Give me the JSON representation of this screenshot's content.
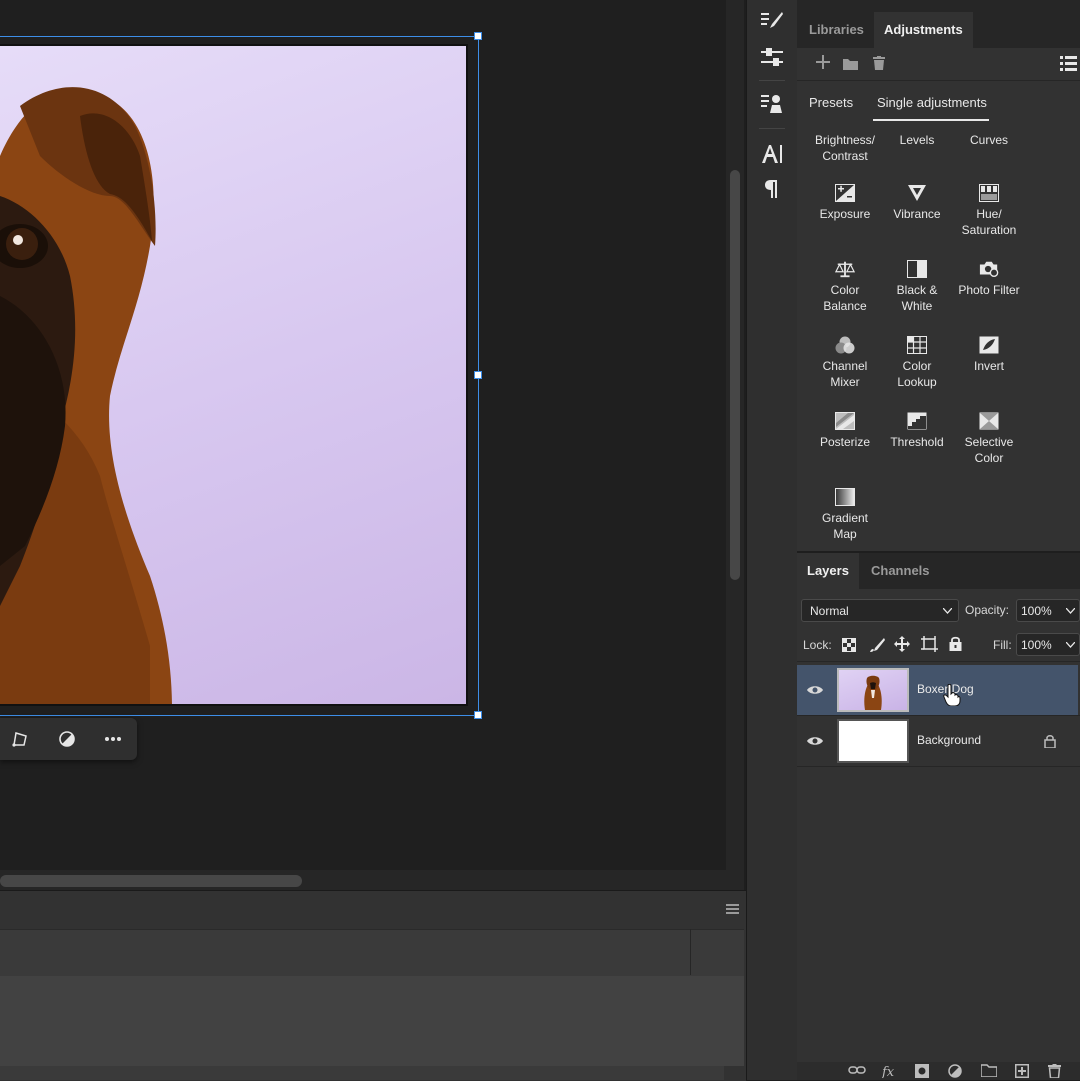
{
  "libraries_panel": {
    "tabs": [
      "Libraries",
      "Adjustments"
    ],
    "active_tab": "Adjustments"
  },
  "adjustments": {
    "subtabs": [
      "Presets",
      "Single adjustments"
    ],
    "active_subtab": "Single adjustments",
    "items": [
      {
        "label": "Brightness/\nContrast",
        "icon": "brightness-contrast-icon"
      },
      {
        "label": "Levels",
        "icon": "levels-icon"
      },
      {
        "label": "Curves",
        "icon": "curves-icon"
      },
      {
        "label": "Exposure",
        "icon": "exposure-icon"
      },
      {
        "label": "Vibrance",
        "icon": "vibrance-icon"
      },
      {
        "label": "Hue/\nSaturation",
        "icon": "hue-saturation-icon"
      },
      {
        "label": "Color\nBalance",
        "icon": "color-balance-icon"
      },
      {
        "label": "Black &\nWhite",
        "icon": "black-white-icon"
      },
      {
        "label": "Photo Filter",
        "icon": "photo-filter-icon"
      },
      {
        "label": "Channel\nMixer",
        "icon": "channel-mixer-icon"
      },
      {
        "label": "Color\nLookup",
        "icon": "color-lookup-icon"
      },
      {
        "label": "Invert",
        "icon": "invert-icon"
      },
      {
        "label": "Posterize",
        "icon": "posterize-icon"
      },
      {
        "label": "Threshold",
        "icon": "threshold-icon"
      },
      {
        "label": "Selective\nColor",
        "icon": "selective-color-icon"
      },
      {
        "label": "Gradient\nMap",
        "icon": "gradient-map-icon"
      }
    ]
  },
  "layers_panel": {
    "tabs": [
      "Layers",
      "Channels"
    ],
    "active_tab": "Layers",
    "blend_mode": "Normal",
    "opacity_label": "Opacity:",
    "opacity_value": "100%",
    "lock_label": "Lock:",
    "fill_label": "Fill:",
    "fill_value": "100%",
    "layers": [
      {
        "name": "Boxer Dog",
        "selected": true,
        "locked": false
      },
      {
        "name": "Background",
        "selected": false,
        "locked": true
      }
    ]
  },
  "colors": {
    "selection_accent": "#3d8ee8",
    "selected_layer": "#44546b",
    "canvas_background": "#e0d2f4"
  }
}
